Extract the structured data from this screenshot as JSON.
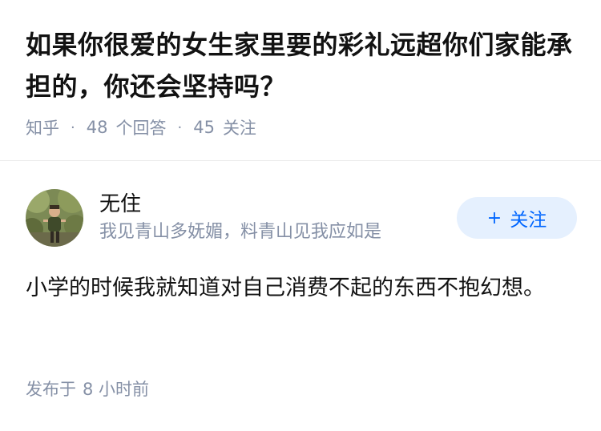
{
  "question": {
    "title": "如果你很爱的女生家里要的彩礼远超你们家能承担的，你还会坚持吗？",
    "source": "知乎",
    "separator": "·",
    "answers_count": "48",
    "answers_label": "个回答",
    "followers_count": "45",
    "followers_label": "关注"
  },
  "answer": {
    "author_name": "无住",
    "author_bio": "我见青山多妩媚，料青山见我应如是",
    "follow_icon": "+",
    "follow_label": "关注",
    "content": "小学的时候我就知道对自己消费不起的东西不抱幻想。",
    "time_prefix": "发布于",
    "time_value": "8 小时前"
  },
  "colors": {
    "accent": "#0066ff",
    "follow_bg": "#e5f0fe",
    "meta_gray": "#8590a6"
  }
}
